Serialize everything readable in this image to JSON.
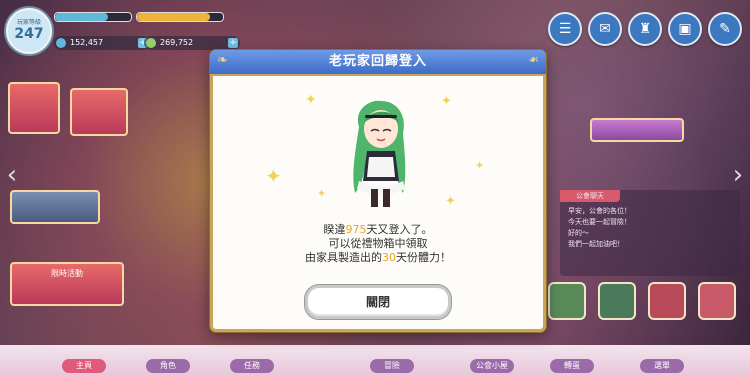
{
  "player": {
    "rank_label": "玩家等級",
    "rank": "247",
    "stat1": "152,457",
    "stat2": "269,752"
  },
  "modal": {
    "title": "老玩家回歸登入",
    "line1_a": "睽違",
    "days": "975",
    "line1_b": "天又登入了。",
    "line2": "可以從禮物箱中領取",
    "line3_a": "由家具製造出的",
    "bonus_days": "30",
    "line3_b": "天份體力！",
    "close_label": "關閉"
  },
  "nav": {
    "items": [
      "主頁",
      "角色",
      "任務",
      "冒險",
      "公會小屋",
      "轉蛋",
      "選單"
    ]
  },
  "chat": {
    "header": "公會聊天",
    "lines": [
      "早安，公會的各位！",
      "今天也要一起冒險！",
      "好的～",
      "我們一起加油吧！"
    ]
  },
  "banner": {
    "label": "限時活動"
  },
  "colors": {
    "accent": "#3c6cc8",
    "highlight": "#e9a51f",
    "gold": "#c9a55a"
  }
}
